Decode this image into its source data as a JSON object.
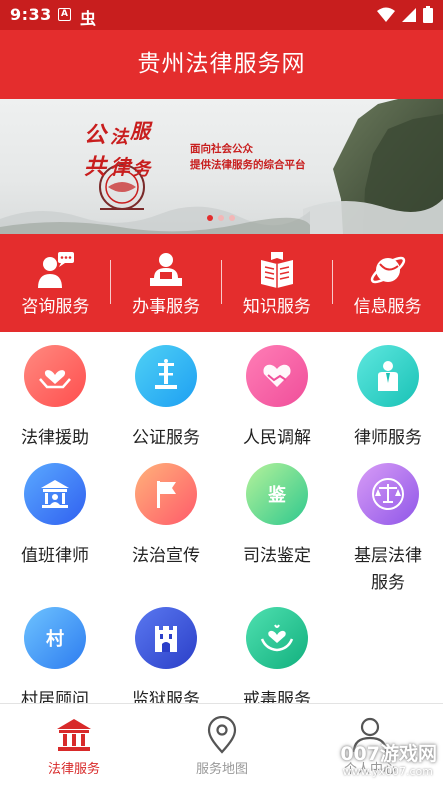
{
  "status_bar": {
    "time": "9:33",
    "notif_a": "A",
    "notif_bug": "虫"
  },
  "header": {
    "title": "贵州法律服务网"
  },
  "banner": {
    "logo_chars": [
      "公",
      "法",
      "服",
      "共",
      "律",
      "务"
    ],
    "tagline_line1": "面向社会公众",
    "tagline_line2": "提供法律服务的综合平台",
    "slides_total": 3,
    "active_slide": 1
  },
  "quick_services": [
    {
      "label": "咨询服务",
      "icon": "consult-icon"
    },
    {
      "label": "办事服务",
      "icon": "office-icon"
    },
    {
      "label": "知识服务",
      "icon": "book-icon"
    },
    {
      "label": "信息服务",
      "icon": "planet-icon"
    }
  ],
  "services": [
    {
      "label": "法律援助",
      "icon": "heart-hands-icon",
      "color_from": "#ff8a80",
      "color_to": "#ff4e4e"
    },
    {
      "label": "公证服务",
      "icon": "notary-icon",
      "color_from": "#4fd1f5",
      "color_to": "#1e9ff2"
    },
    {
      "label": "人民调解",
      "icon": "handshake-icon",
      "color_from": "#ff7eb6",
      "color_to": "#f04e9a"
    },
    {
      "label": "律师服务",
      "icon": "lawyer-icon",
      "color_from": "#5ee7df",
      "color_to": "#19c2b6"
    },
    {
      "label": "值班律师",
      "icon": "courthouse-icon",
      "color_from": "#5aa9ff",
      "color_to": "#3060f0"
    },
    {
      "label": "法治宣传",
      "icon": "flag-icon",
      "color_from": "#ffb27a",
      "color_to": "#ff5a6a"
    },
    {
      "label": "司法鉴定",
      "icon": "appraisal-icon",
      "glyph": "鉴",
      "color_from": "#b6f29a",
      "color_to": "#2ec88e"
    },
    {
      "label": "基层法律服务",
      "label_line1": "基层法律",
      "label_line2": "服务",
      "icon": "scales-icon",
      "color_from": "#d89cf6",
      "color_to": "#8f56e8"
    },
    {
      "label": "村居顾问",
      "icon": "village-icon",
      "glyph": "村",
      "color_from": "#6ec3ff",
      "color_to": "#2d7cf0"
    },
    {
      "label": "监狱服务",
      "icon": "prison-icon",
      "color_from": "#5a78f0",
      "color_to": "#2b3fc8"
    },
    {
      "label": "戒毒服务",
      "icon": "care-hands-icon",
      "color_from": "#4fe0b0",
      "color_to": "#12b07e"
    }
  ],
  "bottom_nav": [
    {
      "label": "法律服务",
      "icon": "bank-icon",
      "active": true
    },
    {
      "label": "服务地图",
      "icon": "map-pin-icon",
      "active": false
    },
    {
      "label": "个人中心",
      "icon": "person-icon",
      "active": false
    }
  ],
  "watermark": {
    "line1": "007游戏网",
    "line2": "www.yx007.com"
  },
  "colors": {
    "primary": "#e42d2d",
    "status_bar": "#c81e1e",
    "nav_active": "#d82a2a",
    "nav_inactive": "#999999"
  }
}
